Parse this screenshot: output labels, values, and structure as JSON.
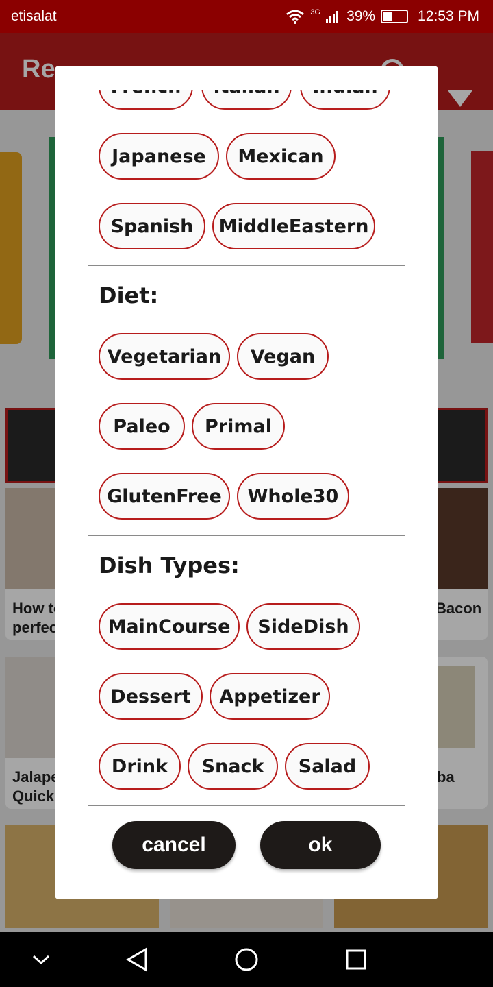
{
  "status_bar": {
    "carrier": "etisalat",
    "network": "3G",
    "battery": "39%",
    "battery_level": 0.39,
    "time": "12:53 PM"
  },
  "app_bar": {
    "title_partial": "Re"
  },
  "background": {
    "card_texts": [
      {
        "text": "How to\nperfec"
      },
      {
        "text": "Bacon"
      },
      {
        "text": "Jalape\nQuick"
      },
      {
        "text": "ba"
      }
    ]
  },
  "dialog": {
    "cuisine_chips_partial": [
      "French",
      "Italian",
      "Indian"
    ],
    "cuisine_chips": [
      "Japanese",
      "Mexican",
      "Spanish",
      "MiddleEastern"
    ],
    "diet_label": "Diet:",
    "diet_chips": [
      "Vegetarian",
      "Vegan",
      "Paleo",
      "Primal",
      "GlutenFree",
      "Whole30"
    ],
    "dish_types_label": "Dish Types:",
    "dish_type_chips": [
      "MainCourse",
      "SideDish",
      "Dessert",
      "Appetizer",
      "Drink",
      "Snack",
      "Salad"
    ],
    "cancel_label": "cancel",
    "ok_label": "ok"
  },
  "colors": {
    "accent": "#b71c1c",
    "status_bar": "#8b0000",
    "button": "#1e1a18"
  },
  "icons": [
    "wifi-icon",
    "signal-icon",
    "battery-icon",
    "search-icon",
    "filter-icon",
    "nav-down-icon",
    "nav-back-icon",
    "nav-home-icon",
    "nav-recents-icon"
  ]
}
